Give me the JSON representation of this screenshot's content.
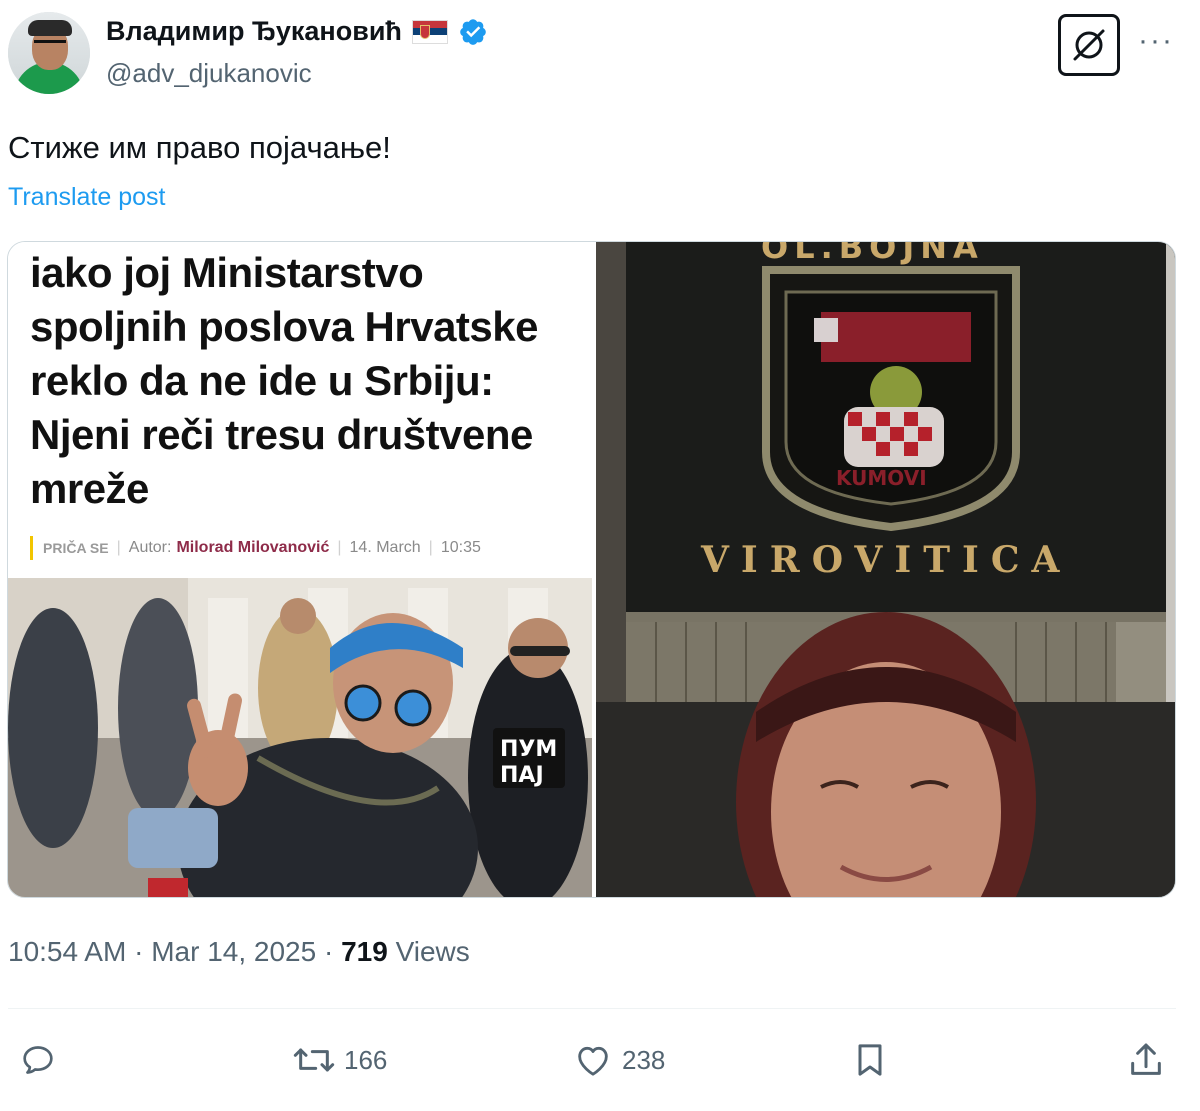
{
  "user": {
    "display_name": "Владимир Ђукановић",
    "handle": "@adv_djukanovic",
    "flag_icon": "serbian-flag-icon",
    "verified_color": "#1d9bf0"
  },
  "post": {
    "text": "Стиже им право појачање!",
    "translate_label": "Translate post"
  },
  "media": {
    "article": {
      "headline": "iako joj Ministarstvo spoljnih poslova Hrvatske reklo da ne ide u Srbiju: Njeni reči tresu društvene mreže",
      "section": "PRIČA SE",
      "author_label": "Autor:",
      "author_name": "Milorad Milovanović",
      "date": "14. March",
      "time": "10:35",
      "shirt_text_1": "ПУМ",
      "shirt_text_2": "ПАЈ"
    },
    "photo": {
      "banner_top_text": "OL.BOJNA",
      "banner_text": "VIROVITICA",
      "badge_text": "KUMOVI"
    }
  },
  "footer": {
    "time": "10:54 AM",
    "separator": "·",
    "date": "Mar 14, 2025",
    "views_count": "719",
    "views_label": "Views"
  },
  "actions": {
    "reply_count": "",
    "repost_count": "166",
    "like_count": "238"
  },
  "colors": {
    "text_primary": "#0f1419",
    "text_secondary": "#536471",
    "link": "#1d9bf0",
    "divider": "#eff3f4"
  }
}
